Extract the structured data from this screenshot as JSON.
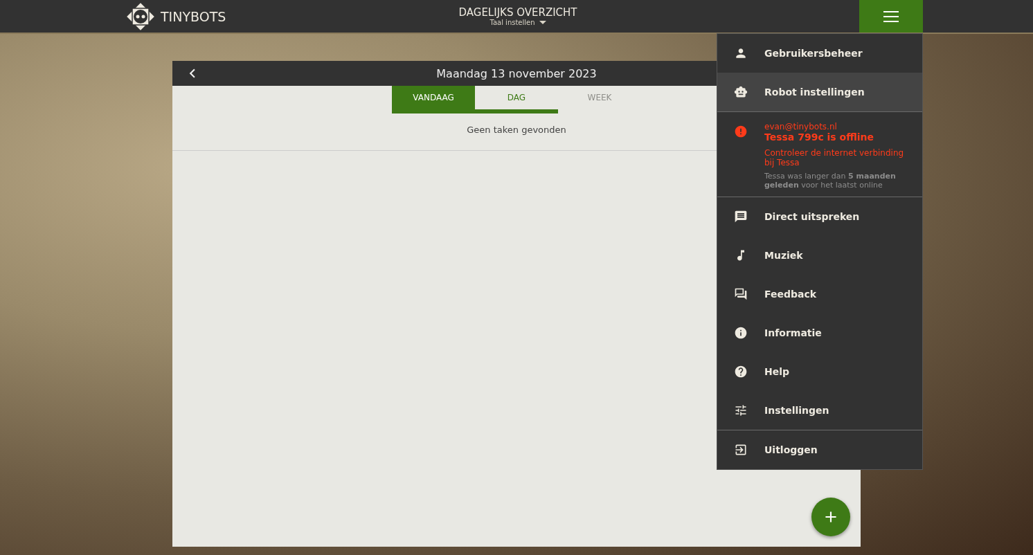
{
  "header": {
    "brand": "TINYBOTS",
    "title": "DAGELIJKS OVERZICHT",
    "language_menu": "Taal instellen"
  },
  "panel": {
    "date": "Maandag 13 november 2023",
    "tabs": [
      {
        "label": "VANDAAG",
        "selected": true,
        "disabled": false,
        "underlined": true
      },
      {
        "label": "DAG",
        "selected": false,
        "disabled": false,
        "underlined": true
      },
      {
        "label": "WEEK",
        "selected": false,
        "disabled": true,
        "underlined": false
      }
    ],
    "empty_message": "Geen taken gevonden"
  },
  "menu": {
    "sections": [
      {
        "items": [
          {
            "kind": "link",
            "label": "Gebruikersbeheer",
            "selected": false
          },
          {
            "kind": "link",
            "label": "Robot instellingen",
            "selected": true
          }
        ]
      },
      {
        "items": [
          {
            "kind": "alert",
            "email": "evan@tinybots.nl",
            "title": "Tessa 799c is offline",
            "message": "Controleer de internet verbinding bij Tessa",
            "note": "Tessa was langer dan **5 maanden geleden** voor het laatst online"
          }
        ]
      },
      {
        "items": [
          {
            "kind": "link",
            "label": "Direct uitspreken",
            "selected": false
          },
          {
            "kind": "link",
            "label": "Muziek",
            "selected": false
          },
          {
            "kind": "link",
            "label": "Feedback",
            "selected": false
          },
          {
            "kind": "link",
            "label": "Informatie",
            "selected": false
          },
          {
            "kind": "link",
            "label": "Help",
            "selected": false
          },
          {
            "kind": "link",
            "label": "Instellingen",
            "selected": false
          }
        ]
      },
      {
        "items": [
          {
            "kind": "link",
            "label": "Uitloggen",
            "selected": false
          }
        ]
      }
    ]
  }
}
